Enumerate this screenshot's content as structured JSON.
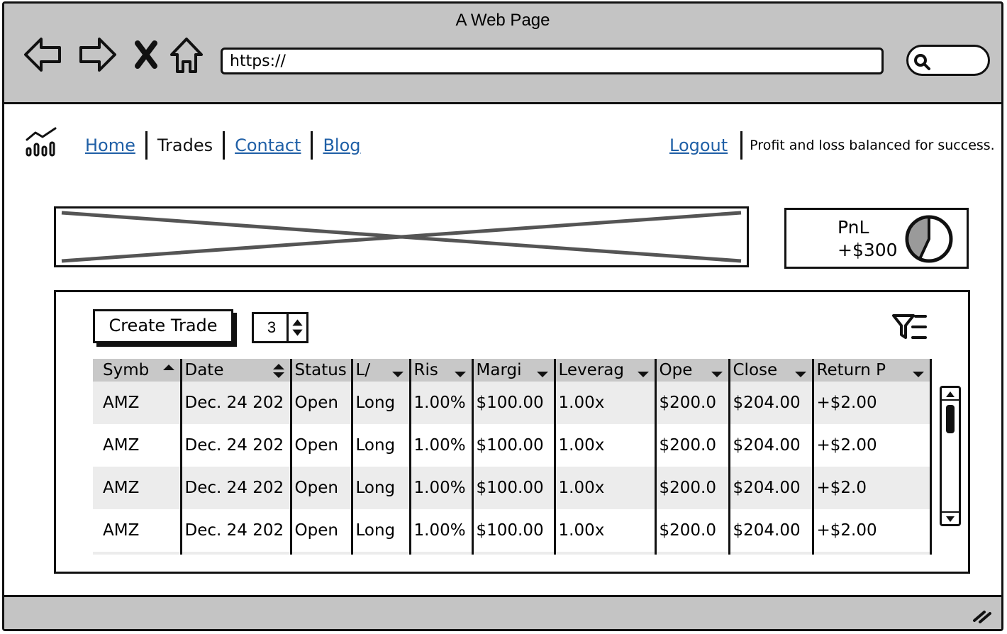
{
  "window": {
    "title": "A Web Page"
  },
  "browser": {
    "address": "https://",
    "nav_icons": [
      "back-arrow-icon",
      "forward-arrow-icon",
      "stop-icon",
      "home-icon"
    ]
  },
  "nav": {
    "links": [
      {
        "label": "Home",
        "current": false
      },
      {
        "label": "Trades",
        "current": true
      },
      {
        "label": "Contact",
        "current": false
      },
      {
        "label": "Blog",
        "current": false
      }
    ],
    "logout": "Logout",
    "tagline": "Profit and loss balanced for success."
  },
  "pnl": {
    "label": "PnL",
    "value": "+$300"
  },
  "toolbar": {
    "create_label": "Create Trade",
    "rows_per_page": "3"
  },
  "table": {
    "columns": [
      "Symb",
      "Date",
      "Status",
      "L/",
      "Ris",
      "Margi",
      "Leverag",
      "Ope",
      "Close",
      "Return P"
    ],
    "rows": [
      [
        "AMZ",
        "Dec. 24 202",
        "Open",
        "Long",
        "1.00%",
        "$100.00",
        "1.00x",
        "$200.0",
        "$204.00",
        "+$2.00"
      ],
      [
        "AMZ",
        "Dec. 24 202",
        "Open",
        "Long",
        "1.00%",
        "$100.00",
        "1.00x",
        "$200.0",
        "$204.00",
        "+$2.00"
      ],
      [
        "AMZ",
        "Dec. 24 202",
        "Open",
        "Long",
        "1.00%",
        "$100.00",
        "1.00x",
        "$200.0",
        "$204.00",
        "+$2.0"
      ],
      [
        "AMZ",
        "Dec. 24 202",
        "Open",
        "Long",
        "1.00%",
        "$100.00",
        "1.00x",
        "$200.0",
        "$204.00",
        "+$2.00"
      ]
    ]
  },
  "colors": {
    "chrome": "#c4c4c4",
    "link": "#1f5fa6",
    "header": "#c8c8c8",
    "row_alt": "#ececec"
  }
}
